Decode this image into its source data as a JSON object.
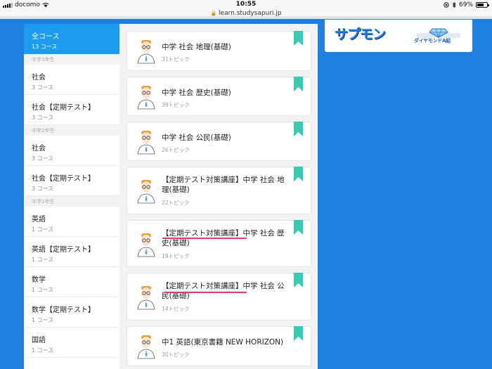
{
  "status_bar": {
    "carrier": "docomo",
    "time": "10:55",
    "battery": "69%",
    "battery_level": 0.69
  },
  "browser": {
    "url": "learn.studysapuri.jp"
  },
  "sidebar": {
    "all": {
      "label": "全コース",
      "count": "13 コース"
    },
    "groups": [
      {
        "label": "中学3年生",
        "items": [
          {
            "label": "社会",
            "count": "3 コース"
          },
          {
            "label": "社会【定期テスト】",
            "count": "3 コース"
          }
        ]
      },
      {
        "label": "中学2年生",
        "items": [
          {
            "label": "社会",
            "count": "3 コース"
          },
          {
            "label": "社会【定期テスト】",
            "count": "3 コース"
          }
        ]
      },
      {
        "label": "中学1年生",
        "items": [
          {
            "label": "英語",
            "count": "1 コース"
          },
          {
            "label": "英語【定期テスト】",
            "count": "1 コース"
          },
          {
            "label": "数学",
            "count": "1 コース"
          },
          {
            "label": "数学【定期テスト】",
            "count": "1 コース"
          },
          {
            "label": "国語",
            "count": "1 コース"
          }
        ]
      }
    ]
  },
  "courses": [
    {
      "title": "中学 社会 地理(基礎)",
      "topics": "31トピック"
    },
    {
      "title": "中学 社会 歴史(基礎)",
      "topics": "39トピック"
    },
    {
      "title": "中学 社会 公民(基礎)",
      "topics": "26トピック"
    },
    {
      "title": "【定期テスト対策講座】中学 社会 地理(基礎)",
      "topics": "22トピック"
    },
    {
      "title": "【定期テスト対策講座】中学 社会 歴史(基礎)",
      "topics": "19トピック"
    },
    {
      "title": "【定期テスト対策講座】中学 社会 公民(基礎)",
      "topics": "14トピック"
    },
    {
      "title": "中1 英語(東京書籍 NEW HORIZON)",
      "topics": "30トピック"
    }
  ],
  "banner": {
    "logo_text": "サプモン",
    "logo2_text": "ダイヤモンドA組"
  },
  "colors": {
    "accent": "#1d9bef",
    "background": "#1f80e0",
    "bookmark": "#3cc9b4",
    "underline": "#e8366a"
  }
}
